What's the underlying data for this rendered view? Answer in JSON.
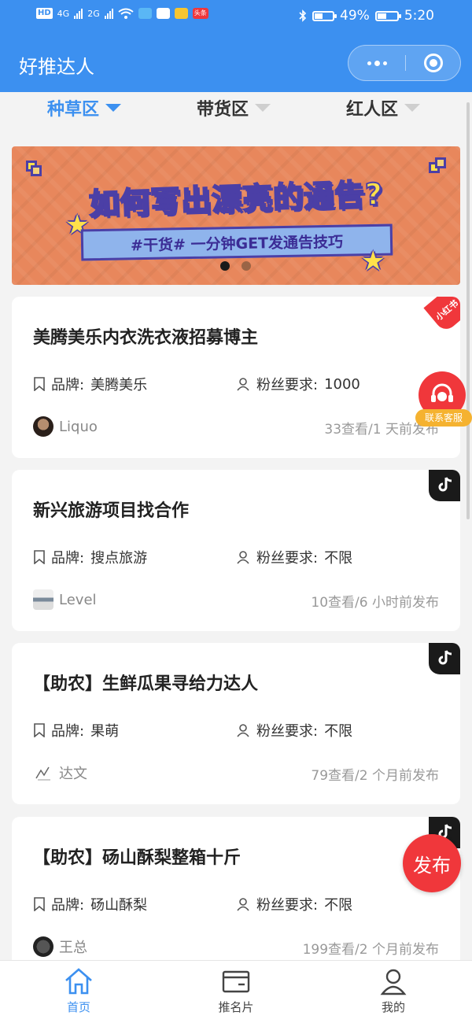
{
  "status_bar": {
    "hd_label": "HD",
    "signal_1_label": "4G",
    "signal_2_label": "2G",
    "mini_app_label": "头条",
    "battery_percent_text": "49%",
    "battery_level": 0.49,
    "time": "5:20"
  },
  "app": {
    "title": "好推达人"
  },
  "category_tabs": [
    {
      "label": "种草区",
      "active": true
    },
    {
      "label": "带货区",
      "active": false
    },
    {
      "label": "红人区",
      "active": false
    }
  ],
  "banner": {
    "headline": "如何写出漂亮的通告?",
    "subtitle": "#干货# 一分钟GET发通告技巧",
    "slide_count": 2,
    "active_slide": 0
  },
  "posts": [
    {
      "title": "美腾美乐内衣洗衣液招募博主",
      "brand_label": "品牌:",
      "brand": "美腾美乐",
      "fans_label": "粉丝要求:",
      "fans": "1000",
      "author": "Liquo",
      "stats": "33查看/1 天前发布",
      "platform": "小红书"
    },
    {
      "title": "新兴旅游项目找合作",
      "brand_label": "品牌:",
      "brand": "搜点旅游",
      "fans_label": "粉丝要求:",
      "fans": "不限",
      "author": "Level",
      "stats": "10查看/6 小时前发布",
      "platform": "抖音"
    },
    {
      "title": "【助农】生鲜瓜果寻给力达人",
      "brand_label": "品牌:",
      "brand": "果萌",
      "fans_label": "粉丝要求:",
      "fans": "不限",
      "author": "达文",
      "stats": "79查看/2 个月前发布",
      "platform": "抖音"
    },
    {
      "title": "【助农】砀山酥梨整箱十斤",
      "brand_label": "品牌:",
      "brand": "砀山酥梨",
      "fans_label": "粉丝要求:",
      "fans": "不限",
      "author": "王总",
      "stats": "199查看/2 个月前发布",
      "platform": "抖音"
    }
  ],
  "floating": {
    "support_label": "联系客服",
    "publish_label": "发布"
  },
  "bottom_nav": [
    {
      "label": "首页",
      "icon": "home-icon",
      "active": true
    },
    {
      "label": "推名片",
      "icon": "card-icon",
      "active": false
    },
    {
      "label": "我的",
      "icon": "user-icon",
      "active": false
    }
  ],
  "colors": {
    "primary": "#3c90f0",
    "accent_red": "#f0373b",
    "support_yellow": "#f5b230",
    "banner_orange": "#e8875c"
  }
}
